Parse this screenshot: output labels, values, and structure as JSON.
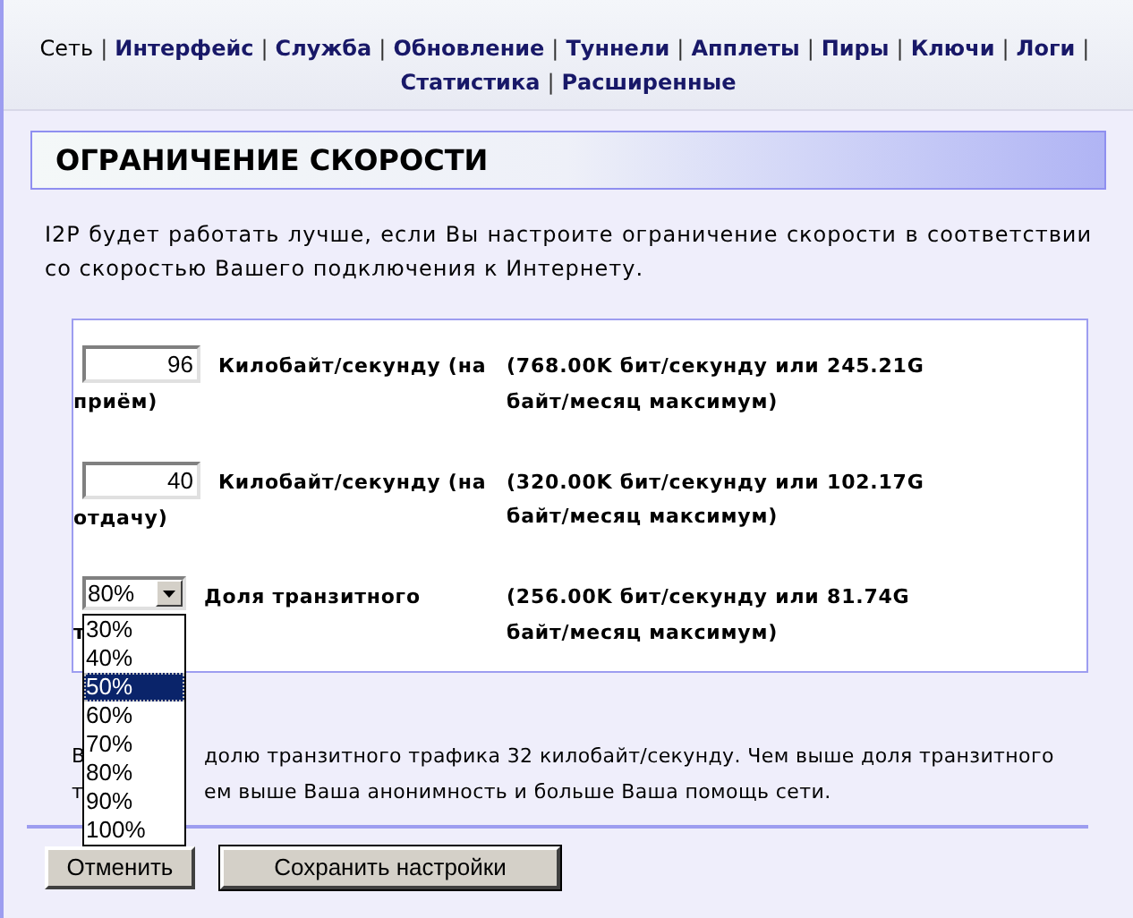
{
  "nav": {
    "separator": "|",
    "items": [
      {
        "label": "Сеть",
        "selected": true
      },
      {
        "label": "Интерфейс",
        "selected": false
      },
      {
        "label": "Служба",
        "selected": false
      },
      {
        "label": "Обновление",
        "selected": false
      },
      {
        "label": "Туннели",
        "selected": false
      },
      {
        "label": "Апплеты",
        "selected": false
      },
      {
        "label": "Пиры",
        "selected": false
      },
      {
        "label": "Ключи",
        "selected": false
      },
      {
        "label": "Логи",
        "selected": false
      },
      {
        "label": "Статистика",
        "selected": false
      },
      {
        "label": "Расширенные",
        "selected": false
      }
    ]
  },
  "heading": "ОГРАНИЧЕНИЕ СКОРОСТИ",
  "intro": "I2P будет работать лучше, если Вы настроите ограничение скорости в соответствии со скоростью Вашего подключения к Интернету.",
  "limits": [
    {
      "kind": "input",
      "value": "96",
      "label": [
        "Килобайт/секунду (на",
        "приём)"
      ],
      "info": [
        "(768.00K бит/секунду или 245.21G",
        "байт/месяц максимум)"
      ]
    },
    {
      "kind": "input",
      "value": "40",
      "label": [
        "Килобайт/секунду (на",
        "отдачу)"
      ],
      "info": [
        "(320.00K бит/секунду или 102.17G",
        "байт/месяц максимум)"
      ]
    },
    {
      "kind": "select",
      "value": "80%",
      "expanded": true,
      "label": [
        "Доля транзитного",
        "т"
      ],
      "info": [
        "(256.00K бит/секунду или 81.74G",
        "байт/месяц максимум)"
      ],
      "options": [
        {
          "label": "30%",
          "highlighted": false
        },
        {
          "label": "40%",
          "highlighted": false
        },
        {
          "label": "50%",
          "highlighted": true
        },
        {
          "label": "60%",
          "highlighted": false
        },
        {
          "label": "70%",
          "highlighted": false
        },
        {
          "label": "80%",
          "highlighted": false
        },
        {
          "label": "90%",
          "highlighted": false
        },
        {
          "label": "100%",
          "highlighted": false
        }
      ]
    }
  ],
  "note_lines": [
    [
      "В",
      "долю транзитного трафика 32 килобайт/секунду. Чем выше доля транзитного"
    ],
    [
      "т",
      "ем выше Ваша анонимность и больше Ваша помощь сети."
    ]
  ],
  "buttons": [
    {
      "label": "Отменить",
      "default": false
    },
    {
      "label": "Сохранить настройки",
      "default": true
    }
  ]
}
